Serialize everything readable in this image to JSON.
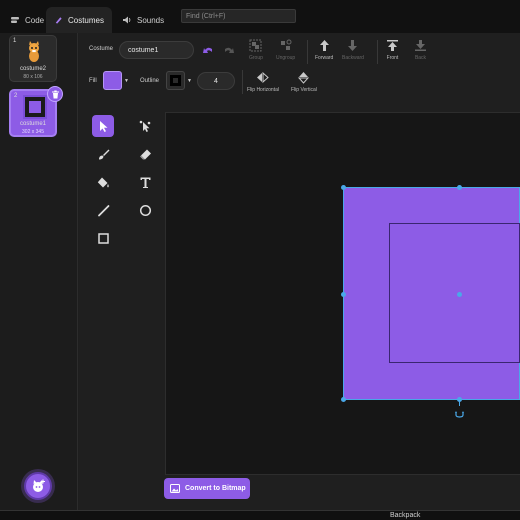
{
  "tabs": {
    "code": "Code",
    "costumes": "Costumes",
    "sounds": "Sounds"
  },
  "find": {
    "placeholder": "Find (Ctrl+F)"
  },
  "costumes": [
    {
      "number": "1",
      "name": "costume2",
      "size": "80 x 106"
    },
    {
      "number": "2",
      "name": "costume1",
      "size": "302 x 345"
    }
  ],
  "editor": {
    "costume_label": "Costume",
    "costume_name": "costume1",
    "fill_label": "Fill",
    "outline_label": "Outline",
    "outline_width": "4",
    "group": "Group",
    "ungroup": "Ungroup",
    "forward": "Forward",
    "backward": "Backward",
    "front": "Front",
    "back": "Back",
    "flip_horizontal": "Flip Horizontal",
    "flip_vertical": "Flip Vertical",
    "convert": "Convert to Bitmap"
  },
  "footer": {
    "backpack": "Backpack"
  },
  "colors": {
    "accent": "#8d5ce6",
    "selection": "#4aa8e8",
    "fill_swatch": "#8d5ce6",
    "outline_swatch": "#000000"
  }
}
